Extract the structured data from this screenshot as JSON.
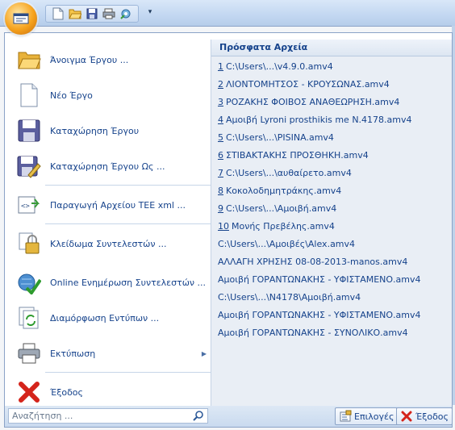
{
  "qat": {
    "icons": [
      "new-document-icon",
      "open-folder-icon",
      "save-icon",
      "print-preview-icon",
      "settings-icon"
    ]
  },
  "menu": {
    "items": [
      {
        "label": "Άνοιγμα Έργου ..."
      },
      {
        "label": "Νέο Έργο"
      },
      {
        "label": "Καταχώρηση Έργου"
      },
      {
        "label": "Καταχώρηση Έργου Ως ..."
      },
      {
        "label": "Παραγωγή Αρχείου ΤΕΕ xml ..."
      },
      {
        "label": "Κλείδωμα Συντελεστών ..."
      },
      {
        "label": "Online Ενημέρωση Συντελεστών ..."
      },
      {
        "label": "Διαμόρφωση Εντύπων ..."
      },
      {
        "label": "Εκτύπωση"
      },
      {
        "label": "Έξοδος"
      }
    ]
  },
  "recent": {
    "title": "Πρόσφατα Αρχεία",
    "files": [
      {
        "num": "1",
        "name": "C:\\Users\\...\\v4.9.0.amv4"
      },
      {
        "num": "2",
        "name": "ΛΙΟΝΤΟΜΗΤΣΟΣ - ΚΡΟΥΣΩΝΑΣ.amv4"
      },
      {
        "num": "3",
        "name": "ΡΟΖΑΚΗΣ ΦΟΙΒΟΣ ΑΝΑΘΕΩΡΗΣΗ.amv4"
      },
      {
        "num": "4",
        "name": "Αμοιβή Lyroni prosthikis me N.4178.amv4"
      },
      {
        "num": "5",
        "name": "C:\\Users\\...\\PISINA.amv4"
      },
      {
        "num": "6",
        "name": "ΣΤΙΒΑΚΤΑΚΗΣ ΠΡΟΣΘΗΚΗ.amv4"
      },
      {
        "num": "7",
        "name": "C:\\Users\\...\\αυθαίρετο.amv4"
      },
      {
        "num": "8",
        "name": "Κοκολοδημητράκης.amv4"
      },
      {
        "num": "9",
        "name": "C:\\Users\\...\\Αμοιβή.amv4"
      },
      {
        "num": "10",
        "name": "Μονής Πρεβέλης.amv4"
      },
      {
        "num": "",
        "name": "C:\\Users\\...\\Αμοιβές\\Alex.amv4"
      },
      {
        "num": "",
        "name": "ΑΛΛΑΓΗ ΧΡΗΣΗΣ 08-08-2013-manos.amv4"
      },
      {
        "num": "",
        "name": "Αμοιβή ΓΟΡΑΝΤΩΝΑΚΗΣ - ΥΦΙΣΤΑΜΕΝΟ.amv4"
      },
      {
        "num": "",
        "name": "C:\\Users\\...\\N4178\\Αμοιβή.amv4"
      },
      {
        "num": "",
        "name": "Αμοιβή ΓΟΡΑΝΤΩΝΑΚΗΣ - ΥΦΙΣΤΑΜΕΝΟ.amv4"
      },
      {
        "num": "",
        "name": "Αμοιβή ΓΟΡΑΝΤΩΝΑΚΗΣ - ΣΥΝΟΛΙΚΟ.amv4"
      }
    ]
  },
  "bottom": {
    "search_placeholder": "Αναζήτηση ...",
    "options_label": "Επιλογές",
    "exit_label": "Έξοδος"
  }
}
